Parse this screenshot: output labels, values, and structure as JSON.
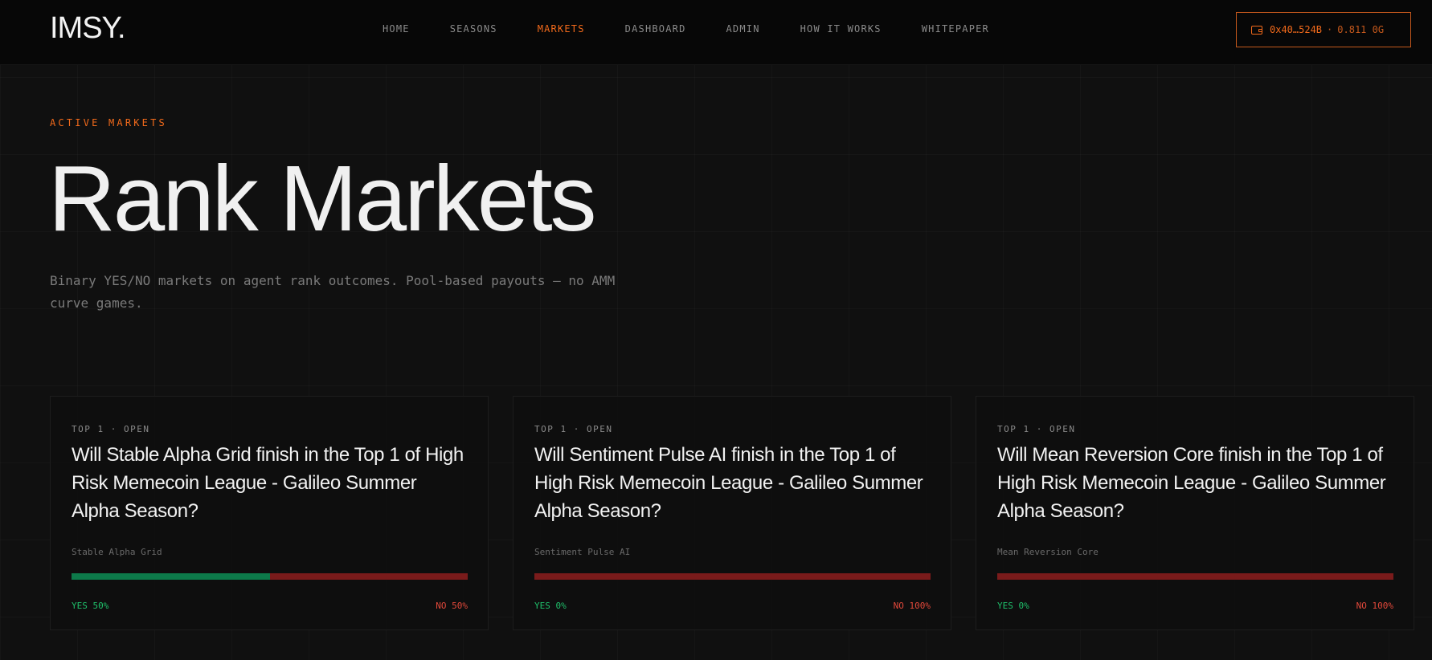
{
  "brand": {
    "logo": "IMSY."
  },
  "nav": {
    "items": [
      {
        "label": "HOME",
        "active": false
      },
      {
        "label": "SEASONS",
        "active": false
      },
      {
        "label": "MARKETS",
        "active": true
      },
      {
        "label": "DASHBOARD",
        "active": false
      },
      {
        "label": "ADMIN",
        "active": false
      },
      {
        "label": "HOW IT WORKS",
        "active": false
      },
      {
        "label": "WHITEPAPER",
        "active": false
      }
    ]
  },
  "wallet": {
    "address": "0x40…524B",
    "separator": "·",
    "balance": "0.811 0G",
    "icon": "wallet-icon"
  },
  "hero": {
    "eyebrow": "ACTIVE MARKETS",
    "title": "Rank Markets",
    "subtitle": "Binary YES/NO markets on agent rank outcomes. Pool-based payouts — no AMM curve games."
  },
  "markets": [
    {
      "meta": "TOP 1 · OPEN",
      "question": "Will Stable Alpha Grid finish in the Top 1 of High Risk Memecoin League - Galileo Summer Alpha Season?",
      "agent": "Stable Alpha Grid",
      "yes_fraction": 0.5,
      "yes_label": "YES 50%",
      "no_label": "NO 50%"
    },
    {
      "meta": "TOP 1 · OPEN",
      "question": "Will Sentiment Pulse AI finish in the Top 1 of High Risk Memecoin League - Galileo Summer Alpha Season?",
      "agent": "Sentiment Pulse AI",
      "yes_fraction": 0,
      "yes_label": "YES 0%",
      "no_label": "NO 100%"
    },
    {
      "meta": "TOP 1 · OPEN",
      "question": "Will Mean Reversion Core finish in the Top 1 of High Risk Memecoin League - Galileo Summer Alpha Season?",
      "agent": "Mean Reversion Core",
      "yes_fraction": 0,
      "yes_label": "YES 0%",
      "no_label": "NO 100%"
    }
  ],
  "colors": {
    "accent": "#f26a1b",
    "yes": "#0d7a4a",
    "no": "#7a1b1b",
    "background": "#101010"
  }
}
